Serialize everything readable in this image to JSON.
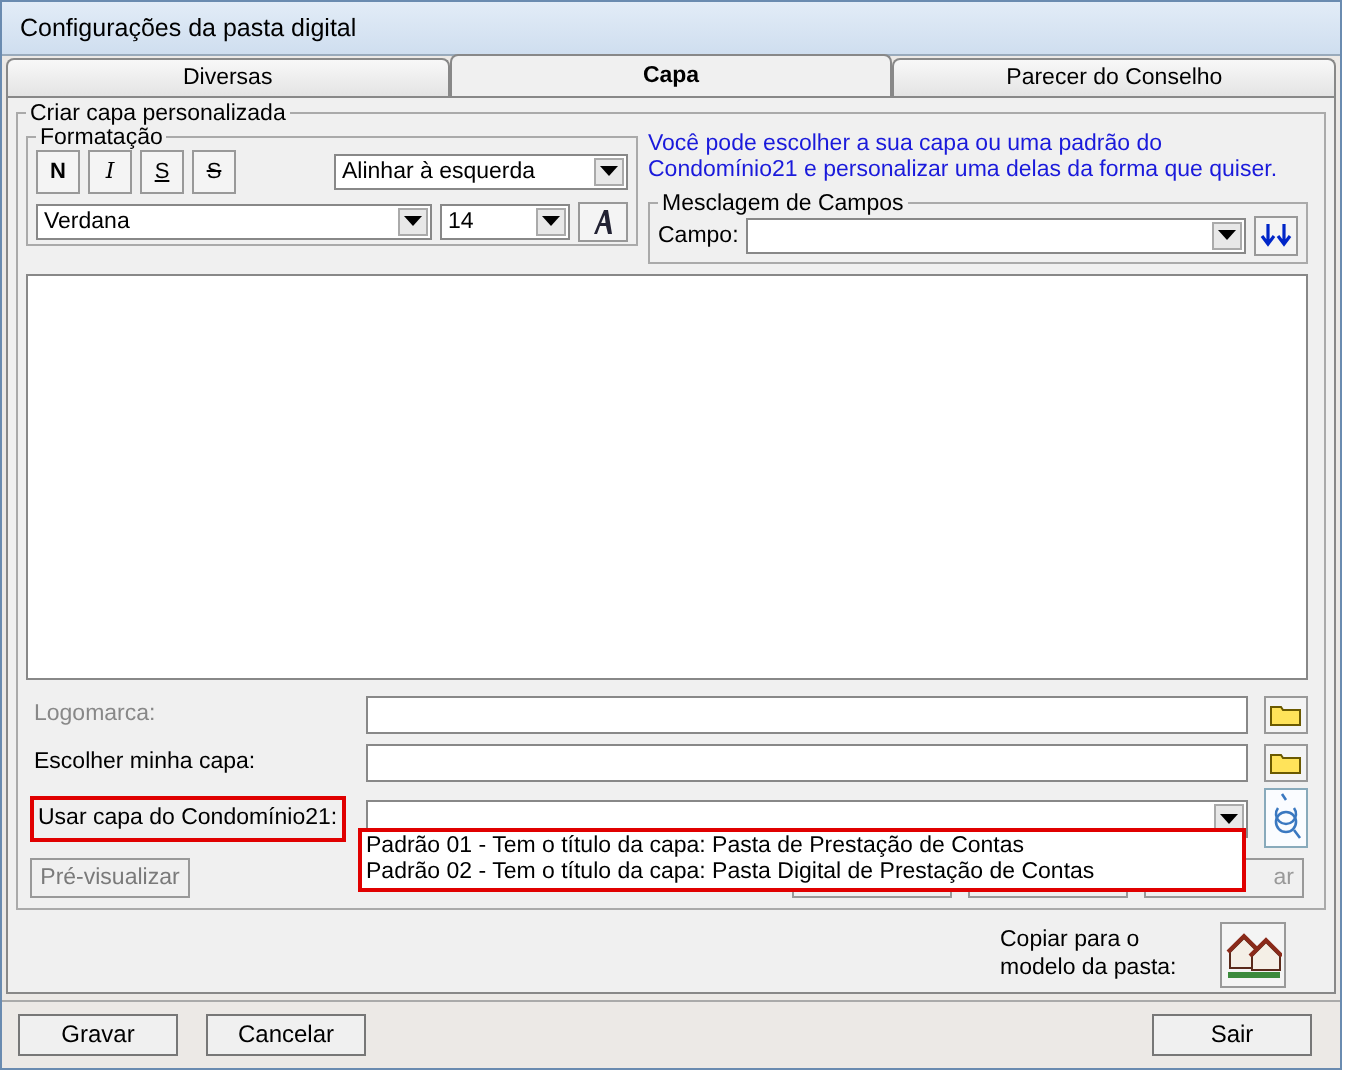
{
  "window": {
    "title": "Configurações da pasta digital"
  },
  "tabs": [
    {
      "label": "Diversas",
      "selected": false
    },
    {
      "label": "Capa",
      "selected": true
    },
    {
      "label": "Parecer do Conselho",
      "selected": false
    }
  ],
  "group_title": "Criar capa personalizada",
  "formatting": {
    "title": "Formatação",
    "style_buttons": [
      {
        "label": "N",
        "kind": "bold"
      },
      {
        "label": "I",
        "kind": "italic"
      },
      {
        "label": "S",
        "kind": "underline"
      },
      {
        "label": "S",
        "kind": "strike"
      }
    ],
    "align": "Alinhar à esquerda",
    "font": "Verdana",
    "size": "14"
  },
  "info_text": "Você pode escolher a sua capa ou uma padrão do Condomínio21 e personalizar uma delas da forma que quiser.",
  "merge": {
    "title": "Mesclagem de Campos",
    "field_label": "Campo:"
  },
  "rows": [
    {
      "label": "Logomarca:",
      "disabled": true,
      "highlighted": false
    },
    {
      "label": "Escolher minha capa:",
      "disabled": false,
      "highlighted": false
    }
  ],
  "template": {
    "label": "Usar capa do Condomínio21:",
    "highlighted": true,
    "options": [
      "Padrão 01 - Tem o título da capa: Pasta de Prestação de Contas",
      "Padrão 02 - Tem o título da capa: Pasta Digital de Prestação de Contas"
    ]
  },
  "preview_button": {
    "label": "Pré-visualizar",
    "disabled": true
  },
  "hidden_button_text": "ar",
  "copy_label": "Copiar para o modelo da pasta:",
  "footer_buttons": [
    {
      "label": "Gravar"
    },
    {
      "label": "Cancelar"
    },
    {
      "label": "Sair"
    }
  ]
}
